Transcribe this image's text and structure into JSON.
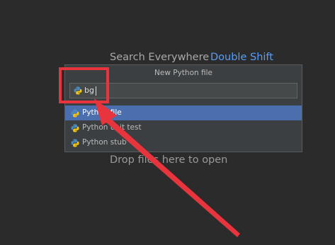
{
  "welcome": {
    "search_label": "Search Everywhere",
    "search_shortcut": "Double Shift",
    "drop_label": "Drop files here to open"
  },
  "dialog": {
    "title": "New Python file",
    "input_value": "bg",
    "items": [
      {
        "label": "Python file",
        "selected": true,
        "icon": "python-file-icon"
      },
      {
        "label": "Python unit test",
        "selected": false,
        "icon": "python-file-icon"
      },
      {
        "label": "Python stub",
        "selected": false,
        "icon": "python-file-icon"
      }
    ]
  },
  "colors": {
    "background": "#2b2b2b",
    "dialog": "#3c3f41",
    "selection": "#4b6eaf",
    "link": "#589df6",
    "annotation": "#e8343c"
  }
}
